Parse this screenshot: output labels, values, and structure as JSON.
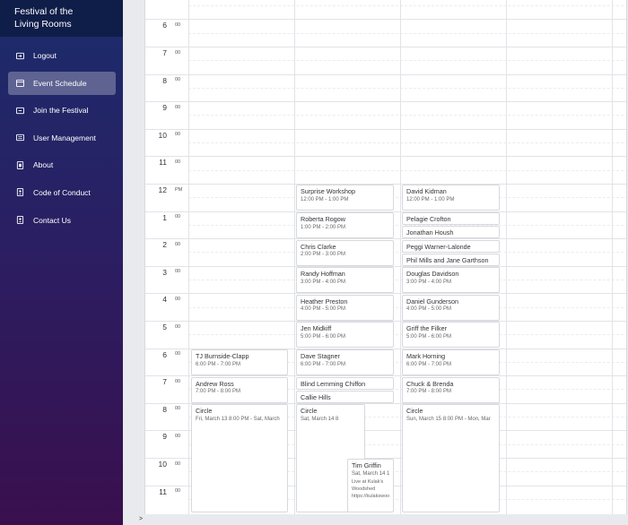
{
  "app": {
    "title_line1": "Festival of the",
    "title_line2": "Living Rooms"
  },
  "nav": [
    {
      "label": "Logout",
      "icon": "logout-icon",
      "active": false
    },
    {
      "label": "Event Schedule",
      "icon": "calendar-icon",
      "active": true
    },
    {
      "label": "Join the Festival",
      "icon": "join-icon",
      "active": false
    },
    {
      "label": "User Management",
      "icon": "users-icon",
      "active": false
    },
    {
      "label": "About",
      "icon": "info-icon",
      "active": false
    },
    {
      "label": "Code of Conduct",
      "icon": "document-icon",
      "active": false
    },
    {
      "label": "Contact Us",
      "icon": "contact-icon",
      "active": false
    }
  ],
  "hours": [
    {
      "num": "6",
      "sup": "00"
    },
    {
      "num": "7",
      "sup": "00"
    },
    {
      "num": "8",
      "sup": "00"
    },
    {
      "num": "9",
      "sup": "00"
    },
    {
      "num": "10",
      "sup": "00"
    },
    {
      "num": "11",
      "sup": "00"
    },
    {
      "num": "12",
      "sup": "PM"
    },
    {
      "num": "1",
      "sup": "00"
    },
    {
      "num": "2",
      "sup": "00"
    },
    {
      "num": "3",
      "sup": "00"
    },
    {
      "num": "4",
      "sup": "00"
    },
    {
      "num": "5",
      "sup": "00"
    },
    {
      "num": "6",
      "sup": "00"
    },
    {
      "num": "7",
      "sup": "00"
    },
    {
      "num": "8",
      "sup": "00"
    },
    {
      "num": "9",
      "sup": "00"
    },
    {
      "num": "10",
      "sup": "00"
    },
    {
      "num": "11",
      "sup": "00"
    }
  ],
  "events": {
    "col_friday": [
      {
        "title": "TJ Burnside-Clapp",
        "time": "6:00 PM - 7:00 PM"
      },
      {
        "title": "Andrew Ross",
        "time": "7:00 PM - 8:00 PM"
      },
      {
        "title": "Circle",
        "time": "Fri, March 13 8:00 PM - Sat, March"
      }
    ],
    "col_saturday": [
      {
        "title": "Surprise Workshop",
        "time": "12:00 PM - 1:00 PM"
      },
      {
        "title": "Roberta Rogow",
        "time": "1:00 PM - 2:00 PM"
      },
      {
        "title": "Chris Clarke",
        "time": "2:00 PM - 3:00 PM"
      },
      {
        "title": "Randy Hoffman",
        "time": "3:00 PM - 4:00 PM"
      },
      {
        "title": "Heather Preston",
        "time": "4:00 PM - 5:00 PM"
      },
      {
        "title": "Jen Midkiff",
        "time": "5:00 PM - 6:00 PM"
      },
      {
        "title": "Dave Stagner",
        "time": "6:00 PM - 7:00 PM"
      },
      {
        "title": "Blind Lemming Chiffon",
        "time": ""
      },
      {
        "title": "Callie Hills",
        "time": ""
      },
      {
        "title": "Circle",
        "time": "Sat, March 14 8"
      },
      {
        "title": "Tim Griffin",
        "time": "Sat, March 14 1",
        "desc1": "Live at Kulak's",
        "desc2": "Woodshed",
        "desc3": "https://kulakswoo"
      }
    ],
    "col_sunday": [
      {
        "title": "David Kidman",
        "time": "12:00 PM - 1:00 PM"
      },
      {
        "title": "Pelagie Crofton",
        "time": ""
      },
      {
        "title": "Jonathan Housh",
        "time": ""
      },
      {
        "title": "Peggi Warner-Lalonde",
        "time": ""
      },
      {
        "title": "Phil Mills and Jane Garthson",
        "time": ""
      },
      {
        "title": "Douglas Davidson",
        "time": "3:00 PM - 4:00 PM"
      },
      {
        "title": "Daniel Gunderson",
        "time": "4:00 PM - 5:00 PM"
      },
      {
        "title": "Griff the Filker",
        "time": "5:00 PM - 6:00 PM"
      },
      {
        "title": "Mark Horning",
        "time": "6:00 PM - 7:00 PM"
      },
      {
        "title": "Chuck & Brenda",
        "time": "7:00 PM - 8:00 PM"
      },
      {
        "title": "Circle",
        "time": "Sun, March 15 8:00 PM - Mon, Mar"
      }
    ]
  },
  "footer": {
    "prompt": ">"
  },
  "colors": {
    "sidebar_top": "#1b2c6b",
    "sidebar_bottom": "#3a0f4e",
    "brand_bg": "#0f1d49"
  }
}
